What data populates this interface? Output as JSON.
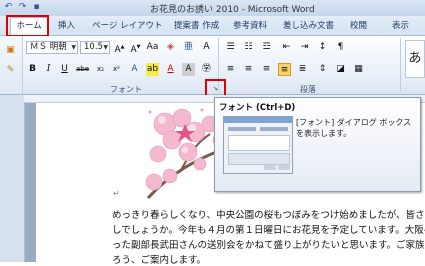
{
  "window": {
    "title": "お花見のお誘い 2010 - Microsoft Word",
    "undo_icon": "undo-icon",
    "quick_save_icon": "save-icon"
  },
  "tabs": [
    {
      "label": "ホーム",
      "selected": true
    },
    {
      "label": "挿入"
    },
    {
      "label": "ページ レイアウト"
    },
    {
      "label": "提案書 作成"
    },
    {
      "label": "参考資料"
    },
    {
      "label": "差し込み文書"
    },
    {
      "label": "校閲"
    },
    {
      "label": "表示"
    }
  ],
  "ribbon": {
    "font_name": "ＭＳ 明朝",
    "font_size": "10.5",
    "font_buttons": [
      "B",
      "I",
      "U",
      "abe",
      "x₂",
      "x²"
    ],
    "font_group_label": "フォント",
    "paragraph_group_label": "段落",
    "styles_preview": "あ",
    "accent_color": "#e00000"
  },
  "tooltip": {
    "title": "フォント (Ctrl+D)",
    "description": "[フォント] ダイアログ ボックスを表示します。"
  },
  "document": {
    "paragraph_mark": "↵",
    "lines": [
      "めっきり春らしくなり、中央公園の桜もつぼみをつけ始めましたが、皆さま",
      "しでしょうか。今年も４月の第１日曜日にお花見を予定しています。大阪へ",
      "った副部長武田さんの送別会をかねて盛り上がりたいと思います。ご家族の",
      "ろう、ご案内します。"
    ]
  }
}
